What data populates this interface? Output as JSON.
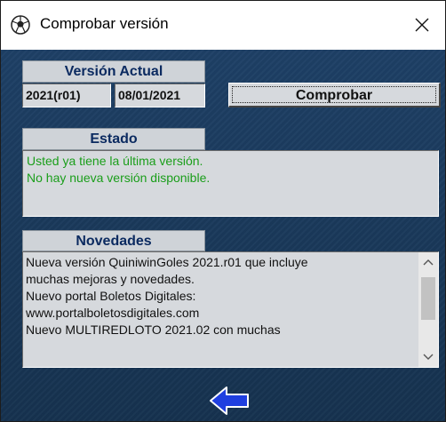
{
  "window": {
    "title": "Comprobar versión",
    "close_glyph": "✕",
    "icons": {
      "app": "soccer-ball-icon",
      "close": "close-icon"
    }
  },
  "current_version": {
    "heading": "Versión Actual",
    "version": "2021(r01)",
    "date": "08/01/2021"
  },
  "check_button": {
    "label": "Comprobar"
  },
  "status": {
    "heading": "Estado",
    "lines": [
      "Usted ya tiene la última versión.",
      "No hay nueva versión disponible."
    ],
    "color": "#1a9e1a"
  },
  "news": {
    "heading": "Novedades",
    "lines": [
      "Nueva versión QuiniwinGoles 2021.r01 que incluye",
      "muchas mejoras y novedades.",
      "Nuevo portal Boletos Digitales:",
      "www.portalboletosdigitales.com",
      "Nuevo MULTIREDLOTO 2021.02 con muchas"
    ]
  },
  "back_button": {
    "icon": "back-arrow-icon",
    "color": "#1f3fe0"
  },
  "colors": {
    "background": "#19385a",
    "heading_text": "#0b2a60"
  }
}
